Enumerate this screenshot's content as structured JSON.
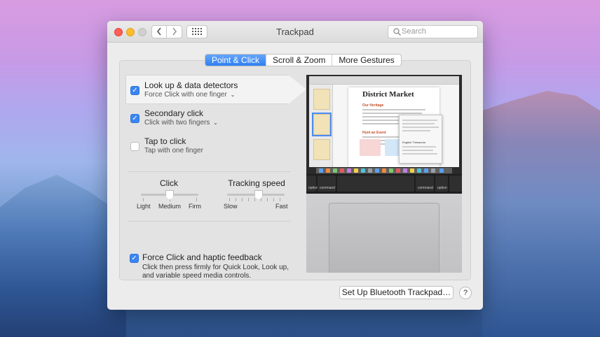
{
  "window": {
    "title": "Trackpad"
  },
  "search": {
    "placeholder": "Search"
  },
  "tabs": [
    {
      "label": "Point & Click",
      "active": true
    },
    {
      "label": "Scroll & Zoom",
      "active": false
    },
    {
      "label": "More Gestures",
      "active": false
    }
  ],
  "options": [
    {
      "title": "Look up & data detectors",
      "subtitle": "Force Click with one finger",
      "checked": true,
      "has_dropdown": true,
      "selected": true
    },
    {
      "title": "Secondary click",
      "subtitle": "Click with two fingers",
      "checked": true,
      "has_dropdown": true,
      "selected": false
    },
    {
      "title": "Tap to click",
      "subtitle": "Tap with one finger",
      "checked": false,
      "has_dropdown": false,
      "selected": false
    }
  ],
  "sliders": {
    "click": {
      "title": "Click",
      "labels": [
        "Light",
        "Medium",
        "Firm"
      ],
      "value": "Medium"
    },
    "tracking": {
      "title": "Tracking speed",
      "min_label": "Slow",
      "max_label": "Fast",
      "value_fraction": 0.55
    }
  },
  "force_click": {
    "title": "Force Click and haptic feedback",
    "description": "Click then press firmly for Quick Look, Look up, and variable speed media controls.",
    "checked": true
  },
  "preview": {
    "doc_title": "District Market",
    "heading1": "Our Heritage",
    "heading2": "Hunt an Event",
    "popup_label": "English Thesaurus",
    "keys": [
      "option",
      "command",
      "command",
      "option"
    ]
  },
  "footer": {
    "bluetooth_button": "Set Up Bluetooth Trackpad…",
    "help": "?"
  },
  "colors": {
    "accent": "#3b86f3"
  },
  "icons": {
    "back": "chevron-left-icon",
    "forward": "chevron-right-icon",
    "grid": "grid-icon",
    "search": "search-icon",
    "check": "checkmark-icon",
    "dropdown": "chevron-down-icon"
  }
}
